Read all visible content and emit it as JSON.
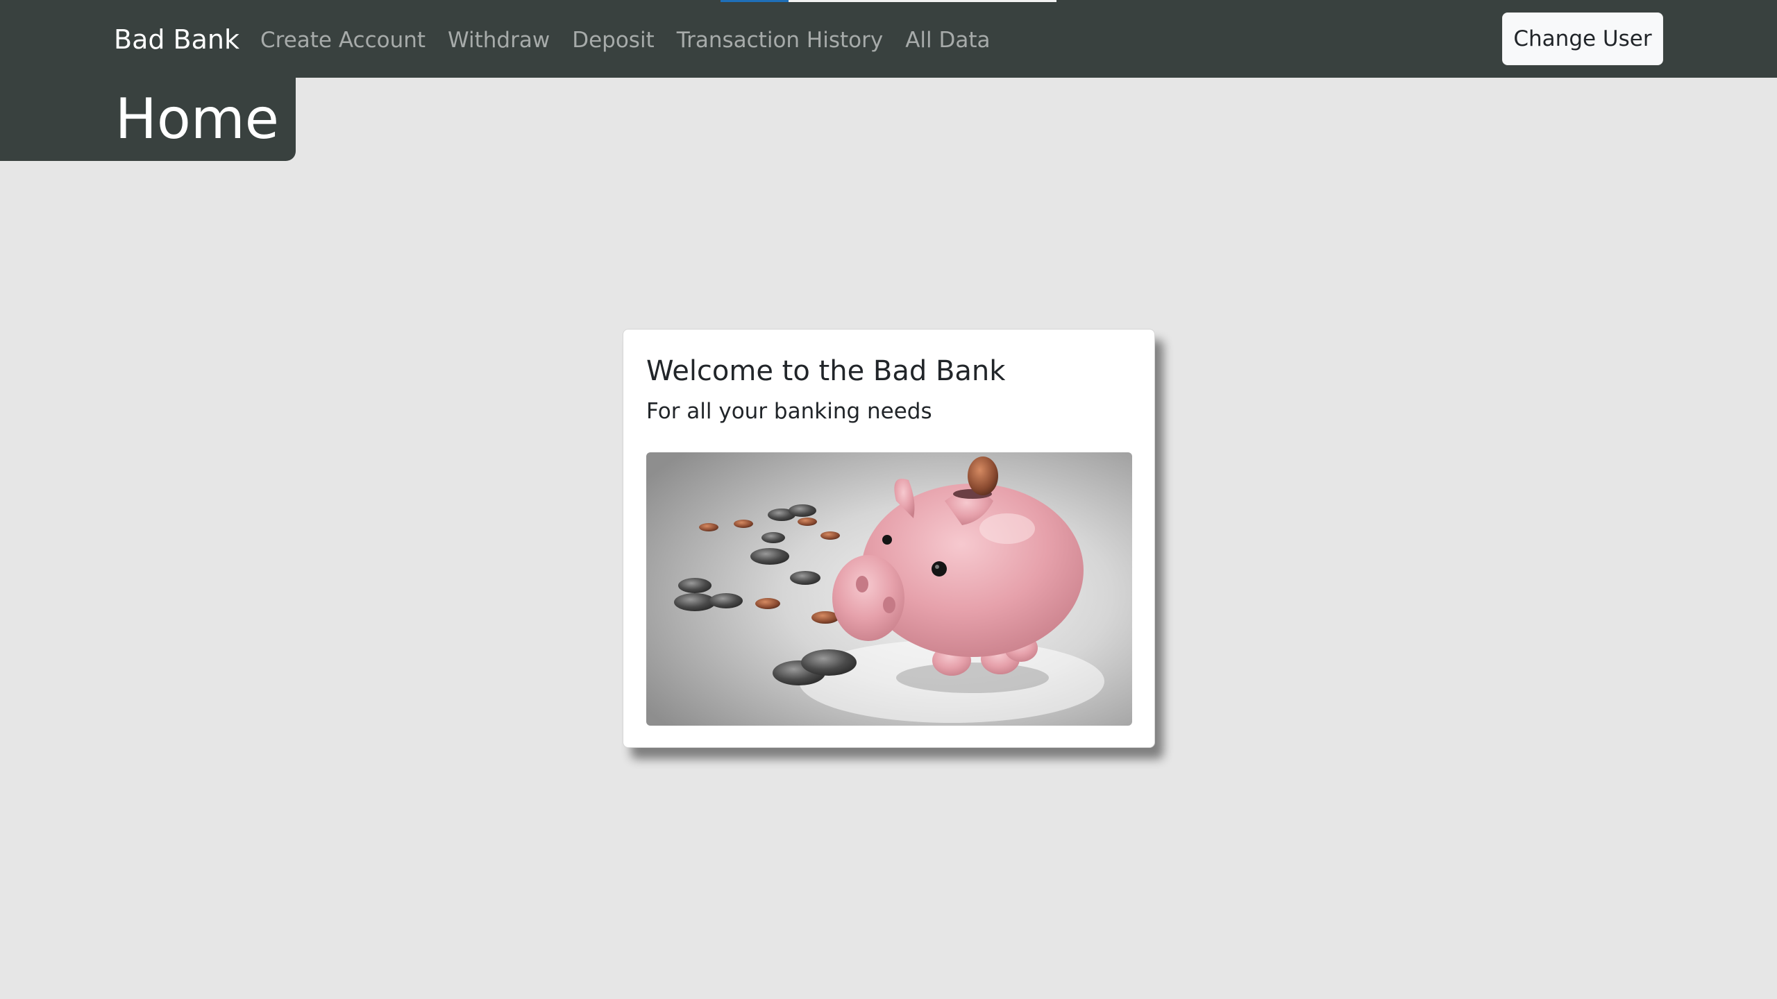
{
  "navbar": {
    "brand": "Bad Bank",
    "links": [
      {
        "label": "Create Account"
      },
      {
        "label": "Withdraw"
      },
      {
        "label": "Deposit"
      },
      {
        "label": "Transaction History"
      },
      {
        "label": "All Data"
      }
    ],
    "change_user_label": "Change User"
  },
  "page": {
    "title": "Home"
  },
  "card": {
    "title": "Welcome to the Bad Bank",
    "subtitle": "For all your banking needs",
    "image_icon": "piggy-bank-with-coins"
  },
  "colors": {
    "navbar_bg": "#39413f",
    "page_bg": "#e6e6e6",
    "nav_link": "#a7abaa",
    "card_bg": "#ffffff",
    "pig_pink": "#e8a3ad"
  }
}
